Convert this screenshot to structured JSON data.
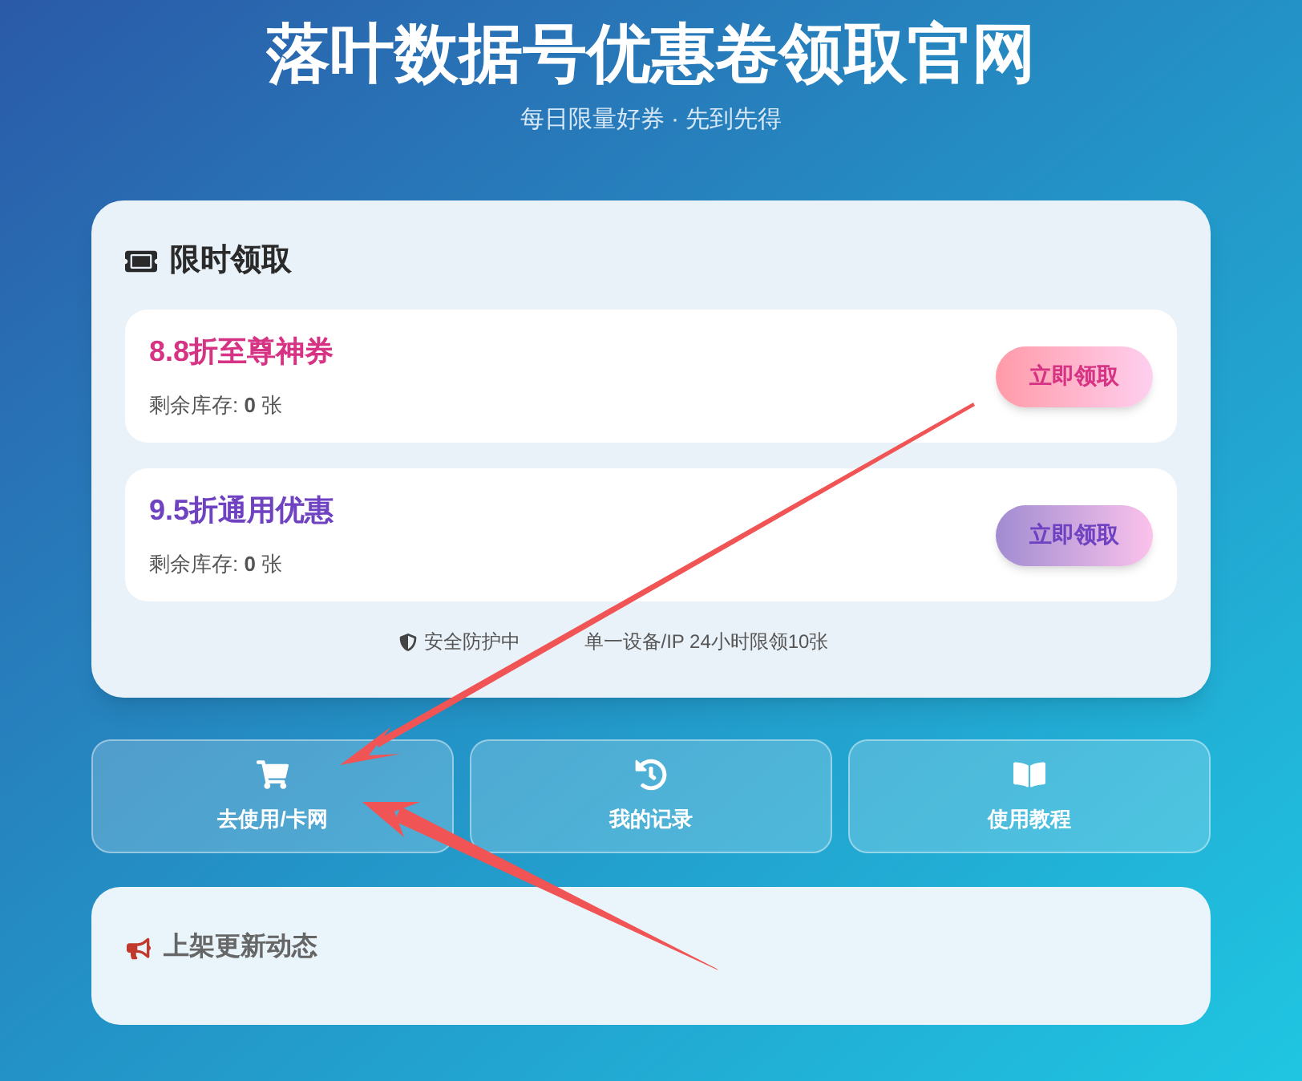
{
  "header": {
    "title": "落叶数据号优惠卷领取官网",
    "subtitle": "每日限量好券 · 先到先得"
  },
  "claim_panel": {
    "heading": "限时领取",
    "coupons": [
      {
        "kind": "premium",
        "title": "8.8折至尊神券",
        "color": "#d63384",
        "stock": "剩余库存: **0** 张",
        "button": "立即领取"
      },
      {
        "kind": "general",
        "title": "9.5折通用优惠",
        "color": "#6f42c1",
        "stock": "剩余库存: **0** 张",
        "button": "立即领取"
      }
    ],
    "notice": [
      "安全防护中",
      "单一设备/IP 24小时限领10张"
    ]
  },
  "actions": [
    {
      "kind": "cart",
      "label": "去使用/卡网"
    },
    {
      "kind": "history",
      "label": "我的记录"
    },
    {
      "kind": "book",
      "label": "使用教程"
    }
  ],
  "news_panel": {
    "heading": "上架更新动态"
  }
}
